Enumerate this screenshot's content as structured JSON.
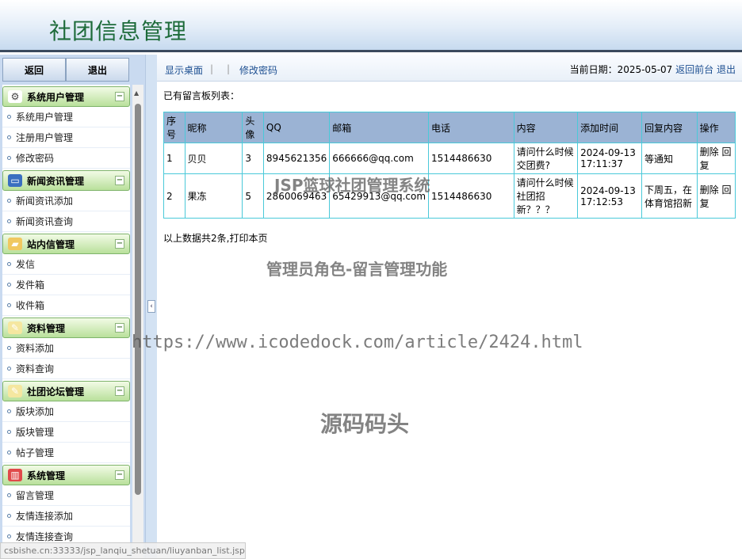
{
  "header": {
    "title": "社团信息管理"
  },
  "left": {
    "back_label": "返回",
    "logout_label": "退出",
    "menus": [
      {
        "title": "系统用户管理",
        "icon": "gear-icon",
        "items": [
          "系统用户管理",
          "注册用户管理",
          "修改密码"
        ]
      },
      {
        "title": "新闻资讯管理",
        "icon": "monitor-icon",
        "items": [
          "新闻资讯添加",
          "新闻资讯查询"
        ]
      },
      {
        "title": "站内信管理",
        "icon": "folder-icon",
        "items": [
          "发信",
          "发件箱",
          "收件箱"
        ]
      },
      {
        "title": "资料管理",
        "icon": "notepad-icon",
        "items": [
          "资料添加",
          "资料查询"
        ]
      },
      {
        "title": "社团论坛管理",
        "icon": "notepad-icon",
        "items": [
          "版块添加",
          "版块管理",
          "帖子管理"
        ]
      },
      {
        "title": "系统管理",
        "icon": "bar-chart-icon",
        "items": [
          "留言管理",
          "友情连接添加",
          "友情连接查询"
        ]
      }
    ]
  },
  "toolbar": {
    "show_desktop": "显示桌面",
    "change_password": "修改密码",
    "date_label": "当前日期：2025-05-07",
    "back_front": "返回前台",
    "logout": "退出"
  },
  "main": {
    "caption": "已有留言板列表：",
    "columns": [
      "序号",
      "昵称",
      "头像",
      "QQ",
      "邮箱",
      "电话",
      "内容",
      "添加时间",
      "回复内容",
      "操作"
    ],
    "rows": [
      [
        "1",
        "贝贝",
        "3",
        "8945621356",
        "666666@qq.com",
        "1514486630",
        "请问什么时候交团费?",
        "2024-09-13 17:11:37",
        "等通知",
        "删除 回复"
      ],
      [
        "2",
        "果冻",
        "5",
        "2860069463",
        "65429913@qq.com",
        "1514486630",
        "请问什么时候社团招新？？？",
        "2024-09-13 17:12:53",
        "下周五，在体育馆招新",
        "删除 回复"
      ]
    ],
    "summary": "以上数据共2条,打印本页"
  },
  "watermarks": {
    "w1": "JSP篮球社团管理系统",
    "w2": "管理员角色-留言管理功能",
    "w3": "https://www.icodedock.com/article/2424.html",
    "w4": "源码码头"
  },
  "statusbar": "csbishe.cn:33333/jsp_lanqiu_shetuan/liuyanban_list.jsp"
}
